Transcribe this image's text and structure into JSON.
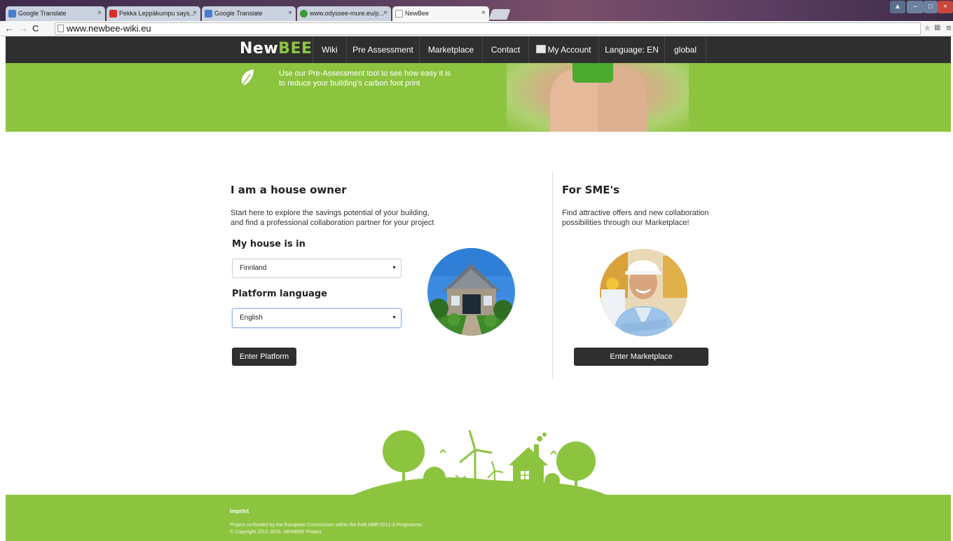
{
  "browser": {
    "tabs": [
      {
        "title": "Google Translate",
        "favicon_color": "#4a7bd0"
      },
      {
        "title": "Pekka Leppäkumpu says...",
        "favicon_color": "#d93025"
      },
      {
        "title": "Google Translate",
        "favicon_color": "#4a7bd0"
      },
      {
        "title": "www.odyssee-mure.eu/p...",
        "favicon_color": "#3a9a3a"
      },
      {
        "title": "NewBee",
        "favicon_color": "#ffffff"
      }
    ],
    "tab_close": "×",
    "url": "www.newbee-wiki.eu",
    "nav": {
      "back": "←",
      "forward": "→",
      "reload": "C"
    },
    "window_controls": {
      "minimize": "–",
      "maximize": "□",
      "close": "×"
    }
  },
  "site": {
    "logo_main": "New",
    "logo_accent": "BEE",
    "nav": [
      "Wiki",
      "Pre Assessment",
      "Marketplace",
      "Contact",
      "My Account",
      "Language: EN",
      "global"
    ]
  },
  "hero": {
    "line1": "Use our Pre-Assessment tool to see how easy it is",
    "line2": "to reduce your building's carbon foot print"
  },
  "owner": {
    "title": "I am a house owner",
    "desc_line1": "Start here to explore the savings potential of your building,",
    "desc_line2": "and find a professional collaboration partner for your project",
    "country_label": "My house is in",
    "country_value": "Finnland",
    "language_label": "Platform language",
    "language_value": "English",
    "button": "Enter Platform"
  },
  "sme": {
    "title": "For SME's",
    "desc_line1": "Find attractive offers and new collaboration",
    "desc_line2": "possibilities through our Marketplace!",
    "button": "Enter Marketplace"
  },
  "footer": {
    "link": "Imprint",
    "note_line1": "Project co-funded by the European Commission within the EeB.NMP.2012-3 Programme.",
    "note_line2": "© Copyright 2012-2015. NEWBEE Project"
  },
  "colors": {
    "brand_green": "#8cc43f",
    "nav_dark": "#2f2f2f"
  }
}
